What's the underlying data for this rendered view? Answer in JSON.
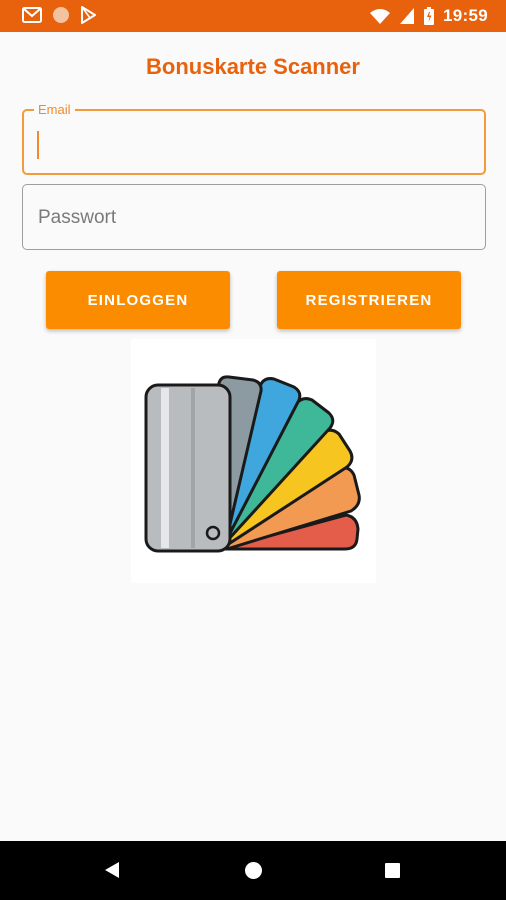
{
  "status_bar": {
    "time": "19:59",
    "left_icons": [
      "gmail-icon",
      "circle-icon",
      "play-store-icon"
    ],
    "right_icons": [
      "wifi-icon",
      "signal-icon",
      "battery-icon"
    ],
    "color": "#e8620e"
  },
  "app": {
    "title": "Bonuskarte Scanner",
    "accent_color": "#fb8c00"
  },
  "form": {
    "email_label": "Email",
    "email_value": "",
    "password_placeholder": "Passwort",
    "password_value": ""
  },
  "buttons": {
    "login_label": "EINLOGGEN",
    "register_label": "REGISTRIEREN"
  },
  "illustration": {
    "icon": "color-swatch-fan-icon",
    "swatch_colors": [
      "#e35d4a",
      "#f29a52",
      "#f7c51f",
      "#3fb89a",
      "#3fa7dd",
      "#8c9aa2",
      "#b9bcbf"
    ]
  },
  "nav_bar": {
    "icons": [
      "back-icon",
      "home-icon",
      "recents-icon"
    ]
  }
}
